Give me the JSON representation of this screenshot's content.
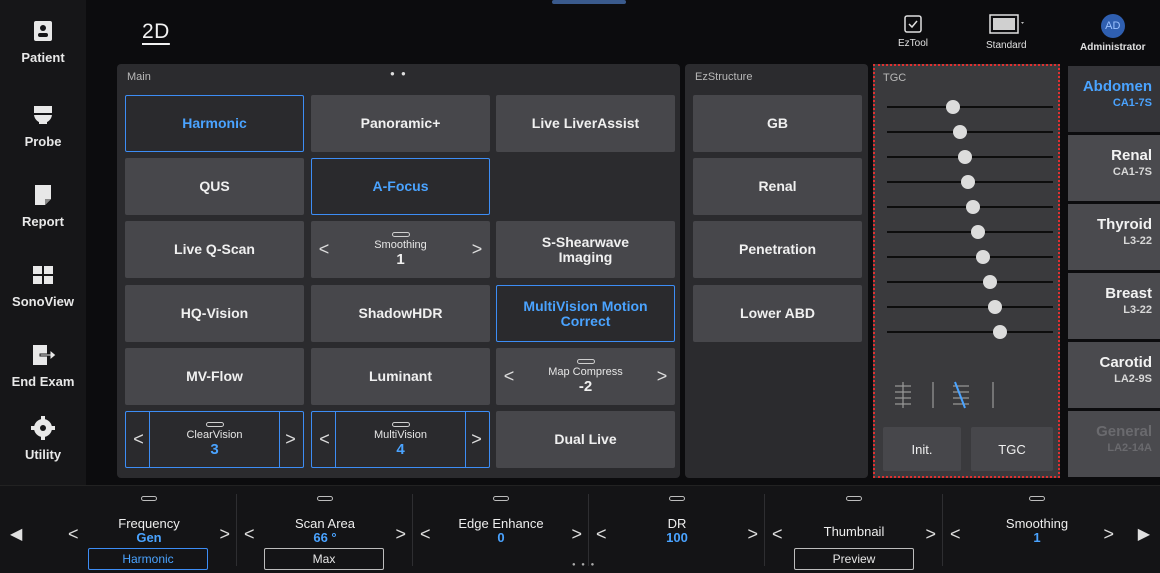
{
  "sidebar": {
    "items": [
      {
        "label": "Patient",
        "icon": "patient-icon"
      },
      {
        "label": "Probe",
        "icon": "probe-icon"
      },
      {
        "label": "Report",
        "icon": "report-icon"
      },
      {
        "label": "SonoView",
        "icon": "sonoview-icon"
      },
      {
        "label": "End Exam",
        "icon": "end-exam-icon"
      },
      {
        "label": "Utility",
        "icon": "gear-icon"
      }
    ]
  },
  "header": {
    "mode": "2D",
    "eztool": "EzTool",
    "standard": "Standard",
    "user_initials": "AD",
    "user": "Administrator"
  },
  "main": {
    "title": "Main",
    "page_dots": "● ●",
    "buttons": {
      "harmonic": "Harmonic",
      "panoramic": "Panoramic+",
      "liveliver": "Live LiverAssist",
      "qus": "QUS",
      "afocus": "A-Focus",
      "liveqscan": "Live Q-Scan",
      "sshear": "S-Shearwave Imaging",
      "hqvision": "HQ-Vision",
      "shadowhdr": "ShadowHDR",
      "mvmotion": "MultiVision Motion Correct",
      "mvflow": "MV-Flow",
      "luminant": "Luminant",
      "duallive": "Dual Live"
    },
    "steppers": {
      "smoothing": {
        "label": "Smoothing",
        "value": "1"
      },
      "mapcompress": {
        "label": "Map Compress",
        "value": "-2"
      },
      "clearvision": {
        "label": "ClearVision",
        "value": "3"
      },
      "multivision": {
        "label": "MultiVision",
        "value": "4"
      }
    }
  },
  "ezstructure": {
    "title": "EzStructure",
    "buttons": [
      "GB",
      "Renal",
      "Penetration",
      "Lower ABD"
    ]
  },
  "tgc": {
    "title": "TGC",
    "levels": [
      0.4,
      0.44,
      0.47,
      0.49,
      0.52,
      0.55,
      0.58,
      0.62,
      0.65,
      0.68
    ],
    "init_label": "Init.",
    "tgc_label": "TGC"
  },
  "presets": [
    {
      "name": "Abdomen",
      "probe": "CA1-7S",
      "state": "selected"
    },
    {
      "name": "Renal",
      "probe": "CA1-7S",
      "state": "normal"
    },
    {
      "name": "Thyroid",
      "probe": "L3-22",
      "state": "normal"
    },
    {
      "name": "Breast",
      "probe": "L3-22",
      "state": "normal"
    },
    {
      "name": "Carotid",
      "probe": "LA2-9S",
      "state": "normal"
    },
    {
      "name": "General",
      "probe": "LA2-14A",
      "state": "disabled"
    }
  ],
  "bottom": {
    "frequency": {
      "label": "Frequency",
      "value": "Gen",
      "sub": "Harmonic"
    },
    "scanarea": {
      "label": "Scan Area",
      "value": "66 °",
      "sub": "Max"
    },
    "edge": {
      "label": "Edge Enhance",
      "value": "0"
    },
    "dr": {
      "label": "DR",
      "value": "100"
    },
    "thumbnail": {
      "label": "Thumbnail",
      "sub": "Preview"
    },
    "smoothing": {
      "label": "Smoothing",
      "value": "1"
    },
    "page_dots": "● ● ●"
  },
  "colors": {
    "accent": "#4aa3ff",
    "tgc_border": "#e03030"
  }
}
